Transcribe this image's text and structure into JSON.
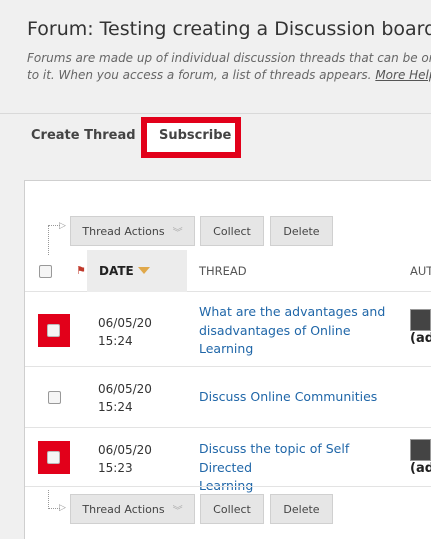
{
  "forum": {
    "title": "Forum: Testing creating a Discussion board dir",
    "description_line1": "Forums are made up of individual discussion threads that can be organi",
    "description_line2": "to it. When you access a forum, a list of threads appears.",
    "more_help": "More Help"
  },
  "tabs": {
    "create_thread": "Create Thread",
    "subscribe": "Subscribe"
  },
  "toolbar": {
    "thread_actions": "Thread Actions",
    "collect": "Collect",
    "delete": "Delete"
  },
  "table": {
    "col_date": "DATE",
    "col_thread": "THREAD",
    "col_author": "AUT",
    "rows": [
      {
        "date": "06/05/20",
        "time": "15:24",
        "thread_line1": "What are the advantages and",
        "thread_line2": "disadvantages of Online",
        "thread_line3": "Learning",
        "author": "(ad"
      },
      {
        "date": "06/05/20",
        "time": "15:24",
        "thread_line1": "Discuss Online Communities",
        "author": ""
      },
      {
        "date": "06/05/20",
        "time": "15:23",
        "thread_line1": "Discuss the topic of Self Directed",
        "thread_line2": "Learning",
        "author": "(ad"
      }
    ]
  },
  "colors": {
    "highlight": "#e2001a",
    "link": "#1f66a8"
  }
}
